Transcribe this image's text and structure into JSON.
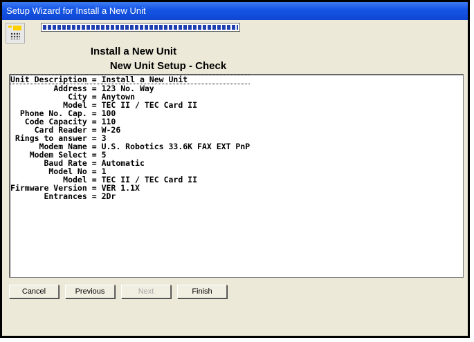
{
  "window": {
    "title": "Setup Wizard for Install a New Unit"
  },
  "wizard": {
    "heading": "Install a New Unit",
    "subheading": "New Unit Setup - Check",
    "progress": 1.0
  },
  "summary": [
    {
      "label": "Unit Description",
      "value": "Install a New Unit"
    },
    {
      "label": "Address",
      "value": "123 No. Way"
    },
    {
      "label": "City",
      "value": "Anytown"
    },
    {
      "label": "Model",
      "value": "TEC II / TEC Card II"
    },
    {
      "label": "Phone No. Cap.",
      "value": "100"
    },
    {
      "label": "Code Capacity",
      "value": "110"
    },
    {
      "label": "Card Reader",
      "value": "W-26"
    },
    {
      "label": "Rings to answer",
      "value": "3"
    },
    {
      "label": "Modem Name",
      "value": "U.S. Robotics 33.6K FAX EXT PnP"
    },
    {
      "label": "Modem Select",
      "value": "5"
    },
    {
      "label": "Baud Rate",
      "value": "Automatic"
    },
    {
      "label": "Model No",
      "value": "1"
    },
    {
      "label": "Model",
      "value": "TEC II / TEC Card II"
    },
    {
      "label": "Firmware Version",
      "value": "VER 1.1X"
    },
    {
      "label": "Entrances",
      "value": "2Dr"
    }
  ],
  "separator": " = ",
  "buttons": {
    "cancel": "Cancel",
    "previous": "Previous",
    "next": "Next",
    "finish": "Finish"
  }
}
